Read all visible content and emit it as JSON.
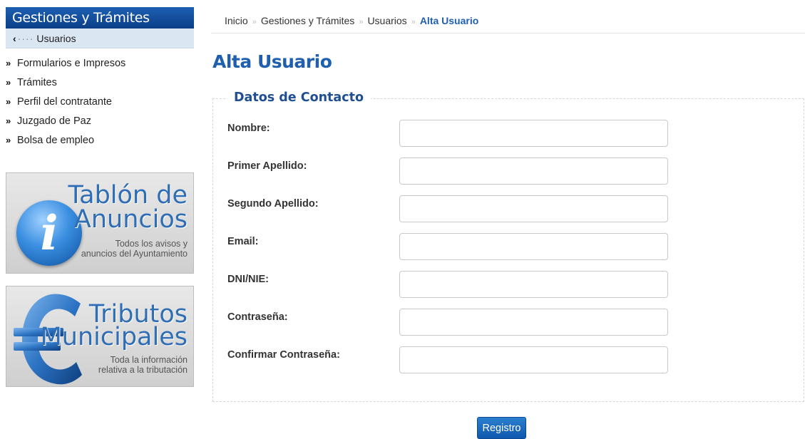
{
  "sidebar": {
    "header": "Gestiones y Trámites",
    "back_label": "Usuarios",
    "menu": [
      "Formularios e Impresos",
      "Trámites",
      "Perfil del contratante",
      "Juzgado de Paz",
      "Bolsa de empleo"
    ],
    "banners": {
      "tablon": {
        "title_line1": "Tablón de",
        "title_line2": "Anuncios",
        "sub_line1": "Todos los avisos y",
        "sub_line2": "anuncios del Ayuntamiento",
        "icon": "info-icon"
      },
      "tributos": {
        "title_line1": "Tributos",
        "title_line2": "Municipales",
        "sub_line1": "Toda la información",
        "sub_line2": "relativa a la tributación",
        "icon": "euro-icon"
      }
    }
  },
  "breadcrumb": {
    "items": [
      "Inicio",
      "Gestiones y Trámites",
      "Usuarios"
    ],
    "separator": "»",
    "current": "Alta Usuario"
  },
  "page": {
    "title": "Alta Usuario",
    "legend": "Datos de Contacto"
  },
  "form": {
    "fields": [
      {
        "label": "Nombre:",
        "value": "",
        "placeholder": ""
      },
      {
        "label": "Primer Apellido:",
        "value": "",
        "placeholder": ""
      },
      {
        "label": "Segundo Apellido:",
        "value": "",
        "placeholder": ""
      },
      {
        "label": "Email:",
        "value": "",
        "placeholder": ""
      },
      {
        "label": "DNI/NIE:",
        "value": "",
        "placeholder": ""
      },
      {
        "label": "Contraseña:",
        "value": "",
        "placeholder": ""
      },
      {
        "label": "Confirmar Contraseña:",
        "value": "",
        "placeholder": ""
      }
    ],
    "submit_label": "Registro"
  },
  "colors": {
    "brand_blue": "#1f5fae",
    "header_blue": "#0b3f87",
    "sidebar_back_bg": "#dbe6f3"
  }
}
